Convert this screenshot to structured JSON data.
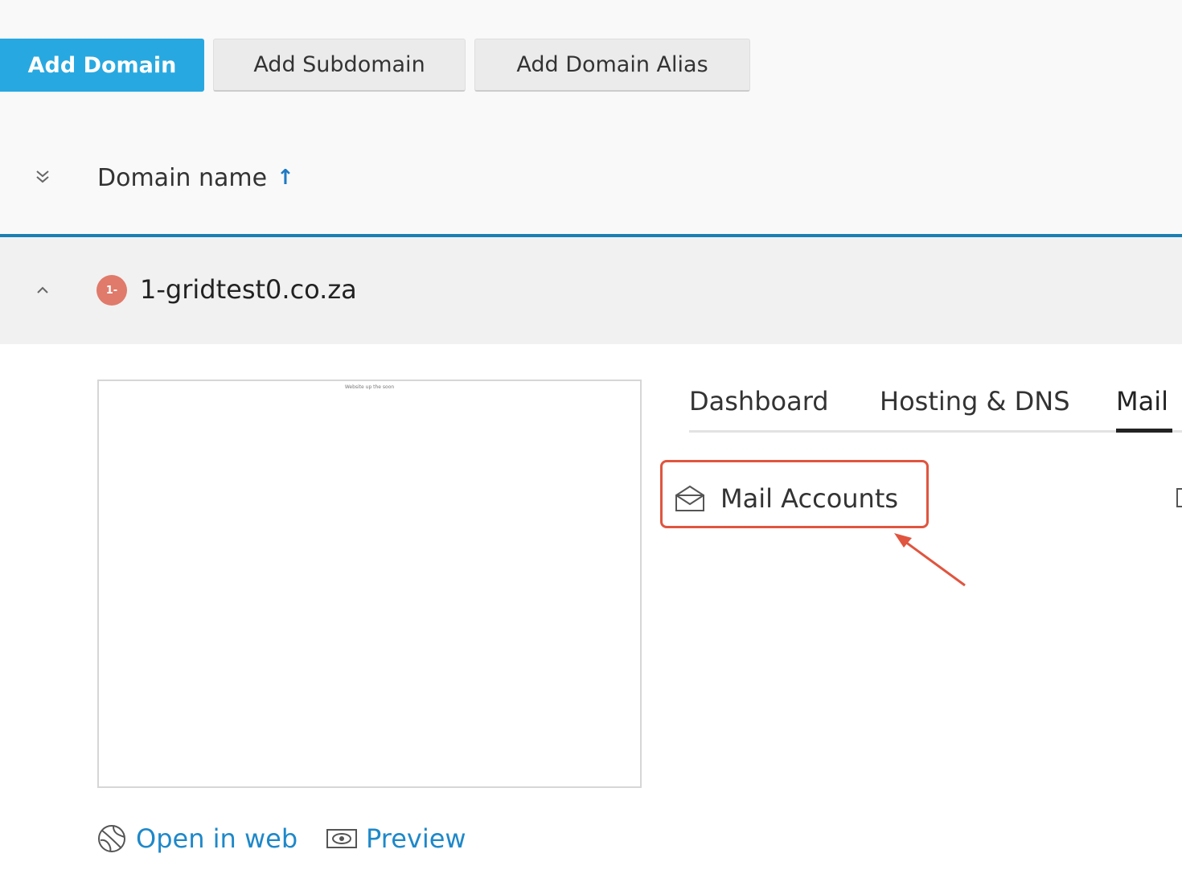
{
  "toolbar": {
    "add_domain": "Add Domain",
    "add_subdomain": "Add Subdomain",
    "add_domain_alias": "Add Domain Alias"
  },
  "list_header": {
    "column_label": "Domain name",
    "sort_indicator": "↑"
  },
  "domain": {
    "name": "1-gridtest0.co.za",
    "badge": "1-",
    "preview_caption": "Website up the soon"
  },
  "tabs": [
    {
      "label": "Dashboard",
      "active": false
    },
    {
      "label": "Hosting & DNS",
      "active": false
    },
    {
      "label": "Mail",
      "active": true
    }
  ],
  "mail_section": {
    "mail_accounts": "Mail Accounts"
  },
  "links": {
    "open_in_web": "Open in web",
    "preview": "Preview"
  },
  "icons": {
    "collapse_all": "double-chevron-down-icon",
    "row_toggle": "chevron-up-icon",
    "mail": "open-envelope-icon",
    "open_in_web": "globe-icon",
    "preview": "eye-icon"
  },
  "colors": {
    "primary": "#28a8e0",
    "link": "#1e88c9",
    "header_line": "#1a7fb3",
    "status_badge": "#e07a6a",
    "highlight": "#e0553f"
  }
}
